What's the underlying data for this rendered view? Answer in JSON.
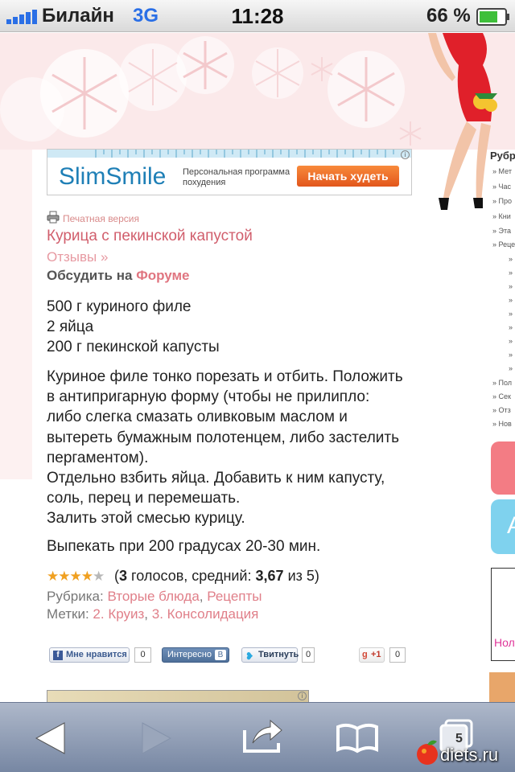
{
  "status_bar": {
    "carrier": "Билайн",
    "network": "3G",
    "time": "11:28",
    "battery": "66 %"
  },
  "ad_banner": {
    "brand": "SlimSmile",
    "subtitle": "Персональная программа похудения",
    "cta": "Начать худеть"
  },
  "article": {
    "print_label": "Печатная версия",
    "title": "Курица с пекинской капустой",
    "reviews_link": "Отзывы »",
    "discuss_prefix": "Обсудить на",
    "discuss_link": "Форуме",
    "ingredients": [
      "500 г куриного филе",
      "2 яйца",
      "200 г пекинской капусты"
    ],
    "instructions": [
      "Куриное филе тонко порезать и отбить. Положить",
      "в антипригарную форму (чтобы не прилипло:",
      "либо слегка смазать оливковым маслом и",
      "вытереть бумажным полотенцем, либо застелить",
      "пергаментом).",
      "Отдельно взбить яйца. Добавить к ним капусту,",
      "соль, перец и перемешать.",
      "Залить этой смесью курицу."
    ],
    "bake": "Выпекать при 200 градусах 20-30 мин.",
    "rating": {
      "stars_filled": 4,
      "stars_total": 5,
      "votes": "3",
      "votes_label": "голосов, средний:",
      "average": "3,67",
      "of_label": "из 5"
    },
    "rubric_label": "Рубрика:",
    "rubric_links": [
      "Вторые блюда",
      "Рецепты"
    ],
    "tags_label": "Метки:",
    "tag_links": [
      "2. Круиз",
      "3. Консолидация"
    ]
  },
  "social": {
    "like_label": "Мне нравится",
    "like_count": "0",
    "vk_label": "Интересно",
    "tweet_label": "Твитнуть",
    "tweet_count": "0",
    "gplus_label": "+1",
    "gplus_count": "0"
  },
  "sidebar": {
    "title": "Рубр",
    "items": [
      "Мет",
      "Час",
      "Про",
      "Кни",
      "Эта",
      "Реце",
      "»",
      "»",
      "»",
      "»",
      "»",
      "»",
      "»",
      "»",
      "»",
      "Пол",
      "Сек",
      "Отз",
      "Нов"
    ],
    "blue_block_letter": "А",
    "ad_text": "Нол"
  },
  "toolbar": {
    "tab_count": "5",
    "watermark": "diets.ru"
  },
  "colors": {
    "link": "#d15e6c",
    "header_pink": "#fbe9ea",
    "toolbar": "#8e9bb4"
  }
}
